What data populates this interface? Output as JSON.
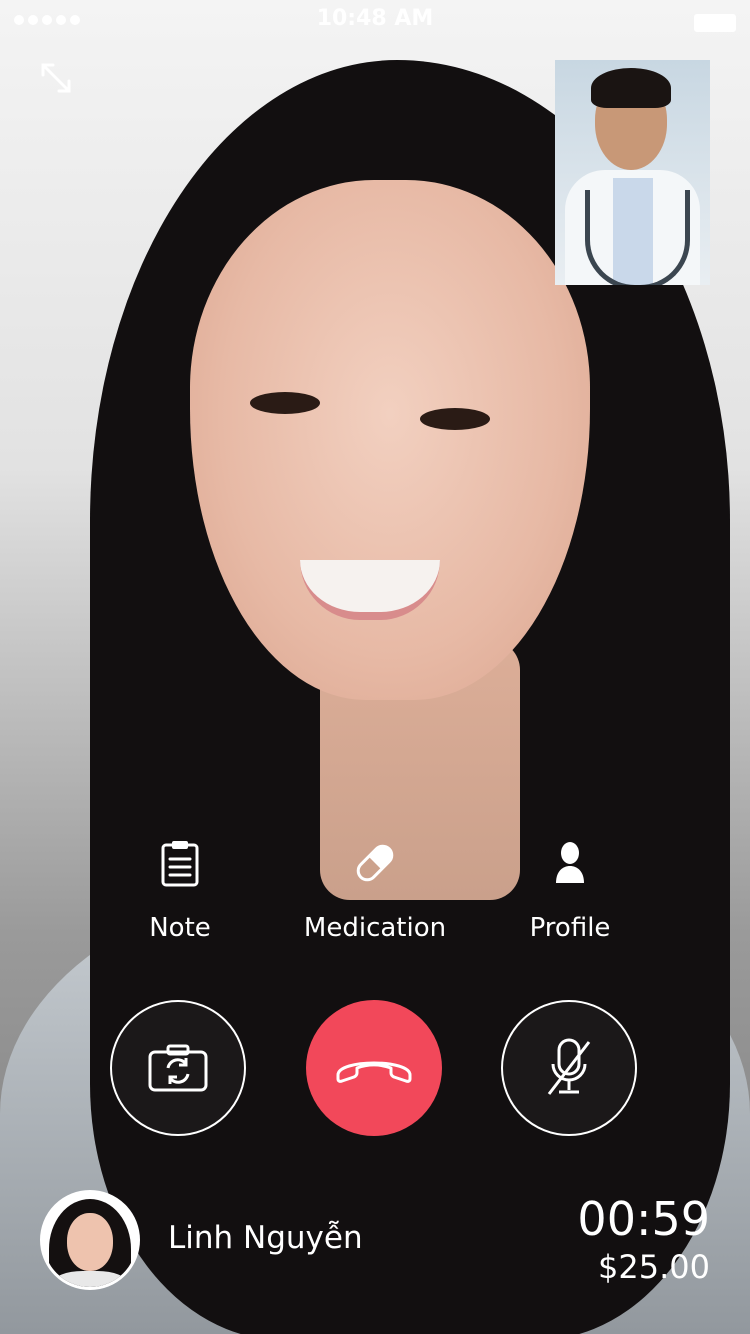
{
  "status_bar": {
    "time": "10:48 AM"
  },
  "actions": [
    {
      "label": "Note",
      "icon": "clipboard-icon"
    },
    {
      "label": "Medication",
      "icon": "pill-icon"
    },
    {
      "label": "Profile",
      "icon": "person-icon"
    }
  ],
  "controls": {
    "switch_camera_icon": "camera-switch-icon",
    "end_call_icon": "phone-hangup-icon",
    "mute_icon": "mic-off-icon",
    "end_call_color": "#f2485a"
  },
  "call": {
    "patient_name": "Linh Nguyễn",
    "timer": "00:59",
    "cost": "$25.00"
  }
}
